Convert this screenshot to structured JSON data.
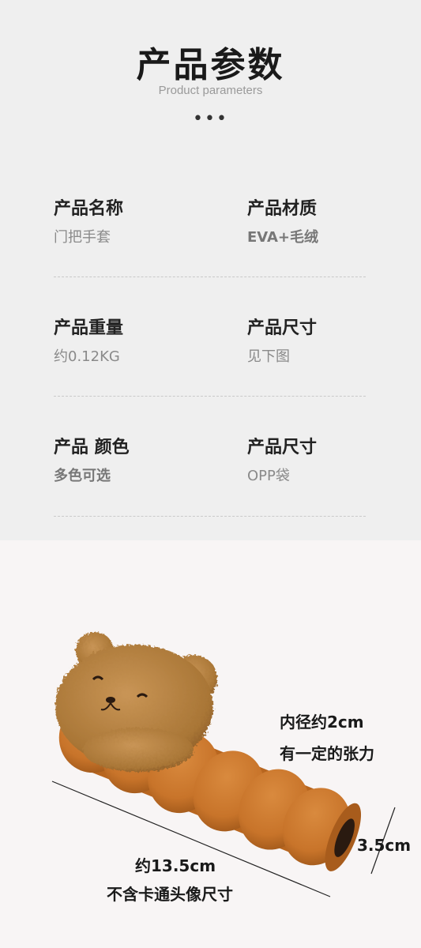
{
  "header": {
    "title": "产品参数",
    "subtitle": "Product parameters",
    "dots": "•••"
  },
  "params": [
    {
      "label": "产品名称",
      "value": "门把手套"
    },
    {
      "label": "产品材质",
      "value": "EVA+毛绒"
    },
    {
      "label": "产品重量",
      "value": "约0.12KG"
    },
    {
      "label": "产品尺寸",
      "value": "见下图"
    },
    {
      "label": "产品 颜色",
      "value": "多色可选"
    },
    {
      "label": "产品尺寸",
      "value": "OPP袋"
    }
  ],
  "dimensions": {
    "inner_diameter": "内径约2cm",
    "tension": "有一定的张力",
    "height": "3.5cm",
    "length": "约13.5cm",
    "length_note": "不含卡通头像尺寸"
  },
  "colors": {
    "foam": "#c8742a",
    "foam_dark": "#a85c1c",
    "plush": "#b98546",
    "plush_dark": "#8f6030"
  }
}
